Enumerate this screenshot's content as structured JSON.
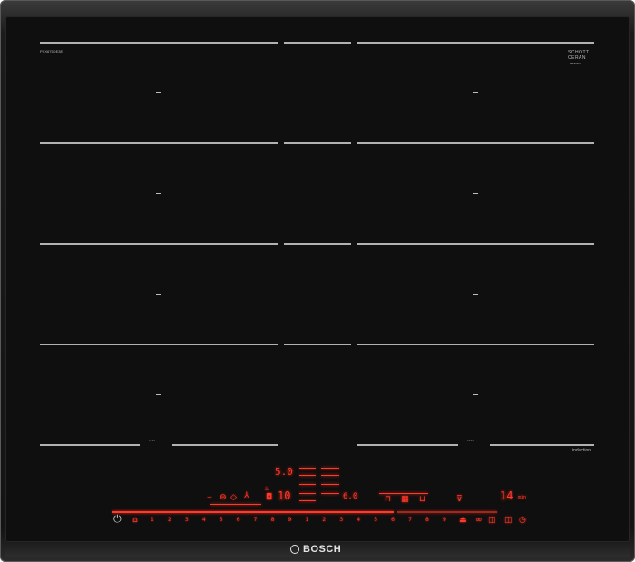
{
  "brand": {
    "logo_text": "BOSCH",
    "model_code": "PXX675DE3E",
    "glass_maker_line1": "SCHOTT",
    "glass_maker_line2": "CERAN",
    "glass_maker_sub": "DESIGN",
    "induction_label": "induction"
  },
  "zones": {
    "flex_marker": "••••"
  },
  "display": {
    "upper_power": "5.0",
    "middle_power": "10",
    "right_power": "6.0",
    "timer": "14",
    "timer_unit": "min"
  },
  "slider": {
    "power_on_symbol": "⏻",
    "levels": [
      "1",
      "2",
      "3",
      "4",
      "5",
      "6",
      "7",
      "8",
      "9",
      "1",
      "2",
      "3",
      "4",
      "5",
      "6",
      "7",
      "8",
      "9"
    ]
  },
  "colors": {
    "glass": "#0f0f0f",
    "frame": "#1b1b1b",
    "led_red": "#ff3a2a",
    "zone_lines": "#cfcfcf"
  },
  "icons": [
    "power-icon",
    "lock-icon",
    "timer-icon",
    "pan-icon",
    "flex-icon",
    "boost-icon"
  ]
}
